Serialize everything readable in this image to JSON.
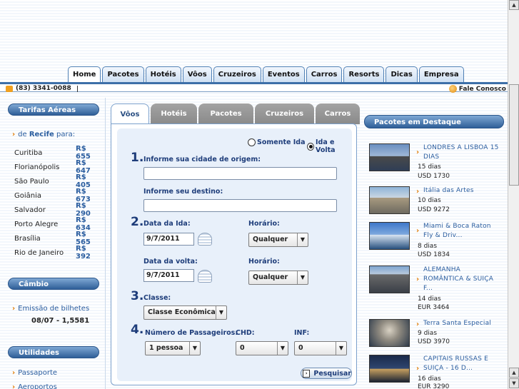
{
  "nav": {
    "tabs": [
      "Home",
      "Pacotes",
      "Hotéis",
      "Vôos",
      "Cruzeiros",
      "Eventos",
      "Carros",
      "Resorts",
      "Dicas",
      "Empresa"
    ],
    "active": "Home"
  },
  "bar": {
    "phone": "(83) 3341-0088",
    "contact": "Fale Conosco"
  },
  "left": {
    "fares_title": "Tarifas Aéreas",
    "from_prefix": "de",
    "from_city": "Recife",
    "from_suffix": "para:",
    "fares": [
      {
        "city": "Curitiba",
        "price": "R$ 655"
      },
      {
        "city": "Florianópolis",
        "price": "R$ 647"
      },
      {
        "city": "São Paulo",
        "price": "R$ 405"
      },
      {
        "city": "Goiânia",
        "price": "R$ 673"
      },
      {
        "city": "Salvador",
        "price": "R$ 290"
      },
      {
        "city": "Porto Alegre",
        "price": "R$ 634"
      },
      {
        "city": "Brasília",
        "price": "R$ 565"
      },
      {
        "city": "Rio de Janeiro",
        "price": "R$ 392"
      }
    ],
    "exchange_title": "Câmbio",
    "exchange_link": "Emissão de bilhetes",
    "exchange_rate": "08/07 - 1,5581",
    "utilities_title": "Utilidades",
    "utilities": [
      "Passaporte",
      "Aeroportos"
    ]
  },
  "search": {
    "tabs": [
      "Vôos",
      "Hotéis",
      "Pacotes",
      "Cruzeiros",
      "Carros"
    ],
    "active_tab": "Vôos",
    "radio_oneway": "Somente Ida",
    "radio_roundtrip": "Ida e Volta",
    "selected_trip": "Ida e Volta",
    "step1": "1.",
    "origin_label": "Informe sua cidade de origem:",
    "origin_value": "",
    "dest_label": "Informe seu destino:",
    "dest_value": "",
    "step2": "2.",
    "depart_label": "Data da Ida:",
    "depart_value": "9/7/2011",
    "time_label": "Horário:",
    "time_value": "Qualquer",
    "return_label": "Data da volta:",
    "return_value": "9/7/2011",
    "return_time_label": "Horário:",
    "return_time_value": "Qualquer",
    "step3": "3.",
    "class_label": "Classe:",
    "class_value": "Classe Econômica",
    "step4": "4.",
    "pax_label": "Número de Passageiros:",
    "pax_value": "1 pessoa",
    "chd_label": "CHD:",
    "chd_value": "0",
    "inf_label": "INF:",
    "inf_value": "0",
    "submit": "Pesquisar"
  },
  "packages": {
    "title": "Pacotes em Destaque",
    "items": [
      {
        "title": "LONDRES A LISBOA 15 DIAS",
        "days": "15 dias",
        "price": "USD 1730"
      },
      {
        "title": "Itália das Artes",
        "days": "10 dias",
        "price": "USD 9272"
      },
      {
        "title": "Miami & Boca Raton Fly & Driv...",
        "days": "8 dias",
        "price": "USD 1834"
      },
      {
        "title": "ALEMANHA ROMÂNTICA & SUIÇA F...",
        "days": "14 dias",
        "price": "EUR 3464"
      },
      {
        "title": "Terra Santa Especial",
        "days": "9 dias",
        "price": "USD 3970"
      },
      {
        "title": "CAPITAIS RUSSAS E SUIÇA - 16 D...",
        "days": "16 dias",
        "price": "EUR 3290"
      }
    ]
  }
}
